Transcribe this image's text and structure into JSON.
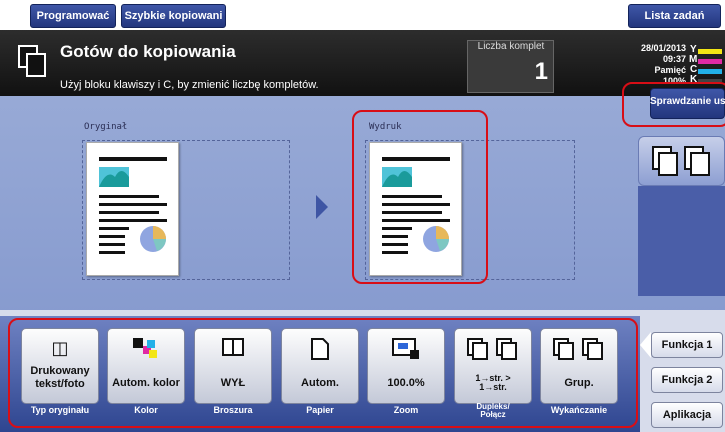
{
  "topbar": {
    "tab_program": "Programować",
    "tab_quick": "Szybkie kopiowani",
    "job_list": "Lista zadań"
  },
  "header": {
    "title": "Gotów do kopiowania",
    "subtitle": "Użyj bloku klawiszy i C, by zmienić liczbę kompletów.",
    "copy_label": "Liczba komplet",
    "copy_count": "1",
    "date": "28/01/2013",
    "time": "09:37",
    "memory_label": "Pamięć",
    "memory_value": "100%",
    "toner": {
      "y": "Y",
      "m": "M",
      "c": "C",
      "k": "K"
    },
    "toner_colors": {
      "y": "#f3e615",
      "m": "#e02aa5",
      "c": "#22b0e8",
      "k": "#333333"
    }
  },
  "check_button": "Sprawdzanie usta",
  "preview": {
    "original_label": "Oryginał",
    "output_label": "Wydruk"
  },
  "functions": [
    {
      "icon": "◫",
      "label1": "Drukowany",
      "label2": "tekst/foto",
      "caption": "Typ oryginału"
    },
    {
      "icon": "",
      "label1": "Autom. kolor",
      "label2": "",
      "caption": "Kolor"
    },
    {
      "icon": "",
      "label1": "WYŁ",
      "label2": "",
      "caption": "Broszura"
    },
    {
      "icon": "",
      "label1": "Autom.",
      "label2": "",
      "caption": "Papier"
    },
    {
      "icon": "",
      "label1": "100.0%",
      "label2": "",
      "caption": "Zoom"
    },
    {
      "icon": "",
      "label1": "1→str. >",
      "label2": "1→str.",
      "caption": "Dupleks/",
      "caption2": "Połącz"
    },
    {
      "icon": "",
      "label1": "Grup.",
      "label2": "",
      "caption": "Wykańczanie"
    }
  ],
  "side": {
    "func1": "Funkcja 1",
    "func2": "Funkcja 2",
    "apps": "Aplikacja"
  },
  "colors": {
    "accent_red": "#d80e16",
    "nav_blue": "#2a3f8f"
  }
}
